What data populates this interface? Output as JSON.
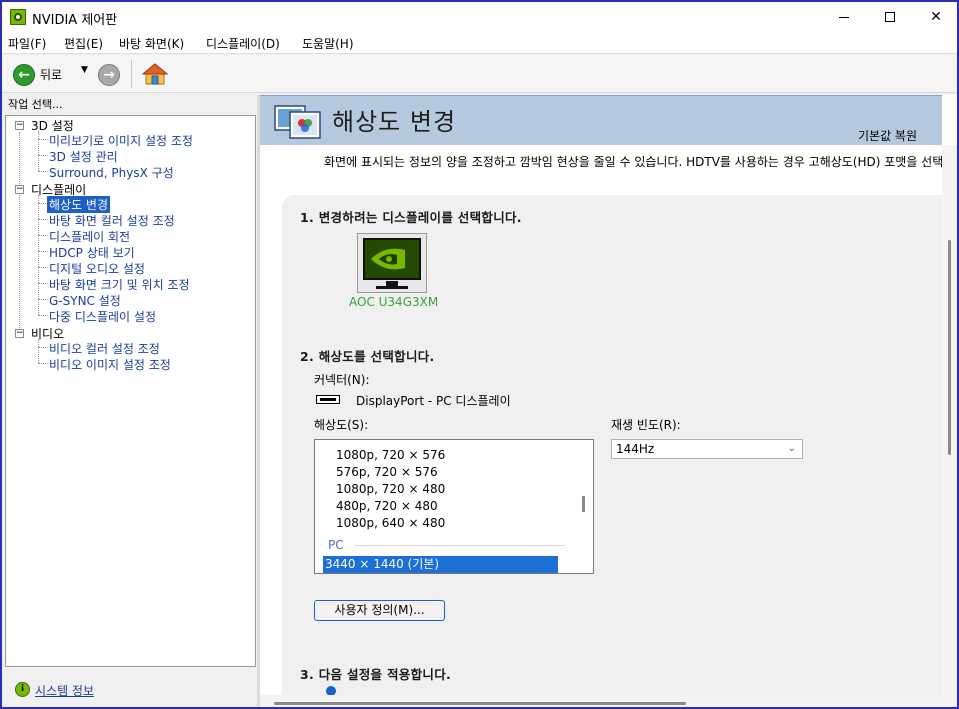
{
  "window": {
    "title": "NVIDIA 제어판",
    "minimize": "",
    "maximize": "",
    "close": "✕"
  },
  "menu": [
    "파일(F)",
    "편집(E)",
    "바탕 화면(K)",
    "디스플레이(D)",
    "도움말(H)"
  ],
  "toolbar": {
    "back_label": "뒤로",
    "back_glyph": "←",
    "forward_glyph": "→",
    "dropdown_glyph": "▼"
  },
  "left": {
    "task_label": "작업 선택...",
    "tree": [
      {
        "label": "3D 설정",
        "type": "category",
        "toggle": "−"
      },
      {
        "label": "미리보기로 이미지 설정 조정",
        "type": "link"
      },
      {
        "label": "3D 설정 관리",
        "type": "link"
      },
      {
        "label": "Surround, PhysX 구성",
        "type": "link"
      },
      {
        "label": "디스플레이",
        "type": "category",
        "toggle": "−"
      },
      {
        "label": "해상도 변경",
        "type": "link",
        "selected": true
      },
      {
        "label": "바탕 화면 컬러 설정 조정",
        "type": "link"
      },
      {
        "label": "디스플레이 회전",
        "type": "link"
      },
      {
        "label": "HDCP 상태 보기",
        "type": "link"
      },
      {
        "label": "디지털 오디오 설정",
        "type": "link"
      },
      {
        "label": "바탕 화면 크기 및 위치 조정",
        "type": "link"
      },
      {
        "label": "G-SYNC 설정",
        "type": "link"
      },
      {
        "label": "다중 디스플레이 설정",
        "type": "link"
      },
      {
        "label": "비디오",
        "type": "category",
        "toggle": "−"
      },
      {
        "label": "비디오 컬러 설정 조정",
        "type": "link"
      },
      {
        "label": "비디오 이미지 설정 조정",
        "type": "link"
      }
    ],
    "system_info": "시스템 정보",
    "system_info_glyph": "i"
  },
  "right": {
    "title": "해상도 변경",
    "restore": "기본값 복원",
    "description": "화면에 표시되는 정보의 양을 조정하고 깜박임 현상을 줄일 수 있습니다. HDTV를 사용하는 경우 고해상도(HD) 포맷을 선택하",
    "section1": "1. 변경하려는 디스플레이를 선택합니다.",
    "monitor_name": "AOC U34G3XM",
    "section2": "2. 해상도를 선택합니다.",
    "connector_label": "커넥터(N):",
    "connector_value": "DisplayPort - PC 디스플레이",
    "resolution_label": "해상도(S):",
    "resolutions": [
      "1080p, 720 × 576",
      "576p, 720 × 576",
      "1080p, 720 × 480",
      "480p, 720 × 480",
      "1080p, 640 × 480"
    ],
    "pc_group": "PC",
    "selected_resolution": "3440 × 1440 (기본)",
    "refresh_label": "재생 빈도(R):",
    "refresh_value": "144Hz",
    "custom_button": "사용자 정의(M)...",
    "section3": "3. 다음 설정을 적용합니다."
  },
  "colors": {
    "accent_blue": "#1c5fc6",
    "nvidia_green": "#76b900",
    "header_band": "#b4c8de",
    "link_blue": "#1a3e9a"
  }
}
